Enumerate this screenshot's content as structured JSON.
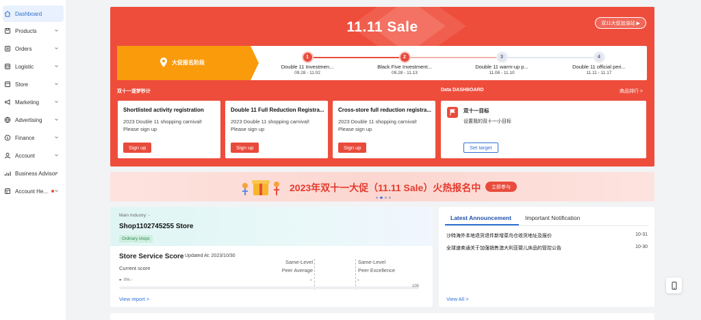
{
  "sidebar": {
    "items": [
      {
        "label": "Dashboard",
        "icon": "home-icon",
        "active": true
      },
      {
        "label": "Products",
        "icon": "products-icon"
      },
      {
        "label": "Orders",
        "icon": "orders-icon"
      },
      {
        "label": "Logistic",
        "icon": "logistic-icon"
      },
      {
        "label": "Store",
        "icon": "store-icon"
      },
      {
        "label": "Marketing",
        "icon": "marketing-icon"
      },
      {
        "label": "Advertising",
        "icon": "advertising-icon"
      },
      {
        "label": "Finance",
        "icon": "finance-icon"
      },
      {
        "label": "Account",
        "icon": "account-icon"
      },
      {
        "label": "Business Advisor",
        "icon": "business-advisor-icon"
      },
      {
        "label": "Account He...",
        "icon": "account-health-icon",
        "dot": true
      }
    ]
  },
  "hero": {
    "title": "11.11 Sale",
    "link_label": "双11大促加油站 ▶",
    "first_stage_label": "大促报名阶段",
    "stages": [
      {
        "num": "1",
        "name": "Double 11 Investmen...",
        "date": "09.28 - 11.02",
        "state": "on"
      },
      {
        "num": "2",
        "name": "Black Five Investment...",
        "date": "09.28 - 11.13",
        "state": "on"
      },
      {
        "num": "3",
        "name": "Double 11 warm-up p...",
        "date": "11.08 - 11.10",
        "state": "off"
      },
      {
        "num": "4",
        "name": "Double 11 official peri...",
        "date": "11.11 - 11.17",
        "state": "off"
      }
    ],
    "left_section_label": "双十一逐梦秒计",
    "right_section_label": "Data DASHBOARD",
    "ranking_link": "商品排行 >",
    "cards": [
      {
        "title": "Shortlisted activity registration",
        "desc1": "2023 Double 11 shopping carnival!",
        "desc2": "Please sign up",
        "button": "Sign up"
      },
      {
        "title": "Double 11 Full Reduction Registra...",
        "desc1": "2023 Double 11 shopping carnival!",
        "desc2": "Please sign up",
        "button": "Sign up"
      },
      {
        "title": "Cross-store full reduction registra...",
        "desc1": "2023 Double 11 shopping carnival!",
        "desc2": "Please sign up",
        "button": "Sign up"
      }
    ],
    "target": {
      "title": "双十一目标",
      "subtitle": "设置我的双十一小目标",
      "button": "Set target"
    }
  },
  "banner": {
    "text": "2023年双十一大促（11.11 Sale）火热报名中",
    "button": "立即参与",
    "dots": 4,
    "active_dot": 1
  },
  "store": {
    "industry": "Main Industry: -",
    "name": "Shop1102745255 Store",
    "tag": "Ordinary shops",
    "score_title": "Store Service Score",
    "updated": "Updated At: 2023/10/30",
    "current_label": "Current score",
    "current_value": "-",
    "zero_pct": "0% -",
    "same_level": "Same-Level",
    "peer_average": "Peer Average",
    "peer_excellence": "Peer Excellence",
    "avg_value": "-",
    "exc_value": "-",
    "max": "100",
    "view_report": "View report >"
  },
  "announcements": {
    "tabs": [
      "Latest Announcement",
      "Important Notification"
    ],
    "rows": [
      {
        "text": "沙特海外本地退货退件新增菜鸟仓收货地址及报价",
        "date": "10-31"
      },
      {
        "text": "全球速卖通关于加强销售澳大利亚婴儿床品的管控公告",
        "date": "10-30"
      }
    ],
    "view_all": "View All >"
  },
  "colors": {
    "accent": "#ee4d3c",
    "primary_blue": "#2e6fd2",
    "stage_orange": "#fa9b0c"
  }
}
